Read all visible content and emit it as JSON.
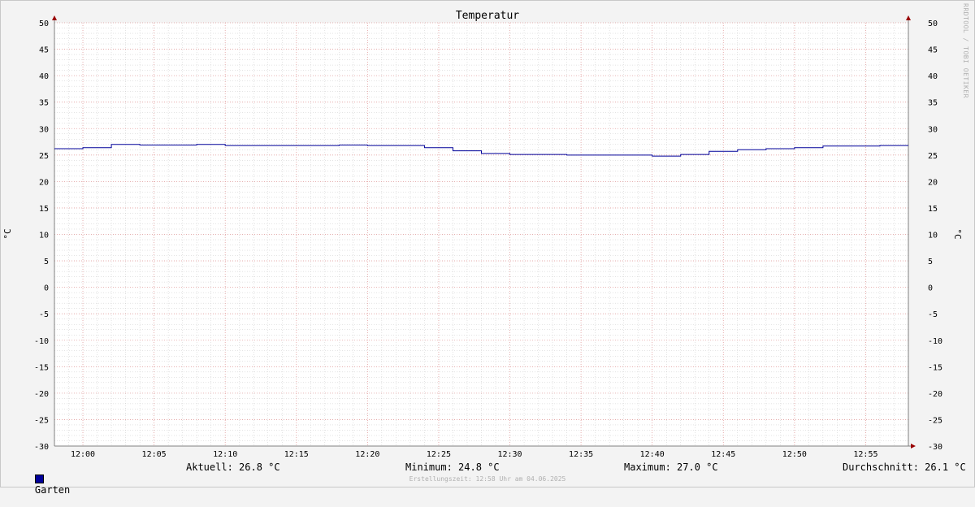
{
  "chart_data": {
    "type": "line",
    "title": "Temperatur",
    "ylabel": "°C",
    "ylim": [
      -30,
      50
    ],
    "y_ticks": [
      50,
      45,
      40,
      35,
      30,
      25,
      20,
      15,
      10,
      5,
      0,
      -5,
      -10,
      -15,
      -20,
      -25,
      -30
    ],
    "xlim": [
      "11:58",
      "12:58"
    ],
    "x_ticks": [
      "12:00",
      "12:05",
      "12:10",
      "12:15",
      "12:20",
      "12:25",
      "12:30",
      "12:35",
      "12:40",
      "12:45",
      "12:50",
      "12:55"
    ],
    "grid": true,
    "legend_position": "bottom-left",
    "series": [
      {
        "name": "Garten",
        "color": "#000099",
        "step": true,
        "points": [
          [
            "11:58",
            26.2
          ],
          [
            "12:00",
            26.4
          ],
          [
            "12:02",
            27.0
          ],
          [
            "12:04",
            26.9
          ],
          [
            "12:08",
            27.0
          ],
          [
            "12:10",
            26.8
          ],
          [
            "12:18",
            26.9
          ],
          [
            "12:20",
            26.8
          ],
          [
            "12:24",
            26.4
          ],
          [
            "12:26",
            25.8
          ],
          [
            "12:28",
            25.3
          ],
          [
            "12:30",
            25.1
          ],
          [
            "12:34",
            25.0
          ],
          [
            "12:40",
            24.8
          ],
          [
            "12:42",
            25.1
          ],
          [
            "12:44",
            25.7
          ],
          [
            "12:46",
            26.0
          ],
          [
            "12:48",
            26.2
          ],
          [
            "12:50",
            26.4
          ],
          [
            "12:52",
            26.7
          ],
          [
            "12:56",
            26.8
          ],
          [
            "12:58",
            26.8
          ]
        ]
      }
    ]
  },
  "legend": {
    "series_name": "Garten",
    "swatch_color": "#000099",
    "current": "Aktuell: 26.8 °C",
    "minimum": "Minimum: 24.8 °C",
    "maximum": "Maximum: 27.0 °C",
    "average": "Durchschnitt: 26.1 °C"
  },
  "footer": "Erstellungszeit: 12:58 Uhr am 04.06.2025",
  "watermark": "RRDTOOL / TOBI OETIKER"
}
